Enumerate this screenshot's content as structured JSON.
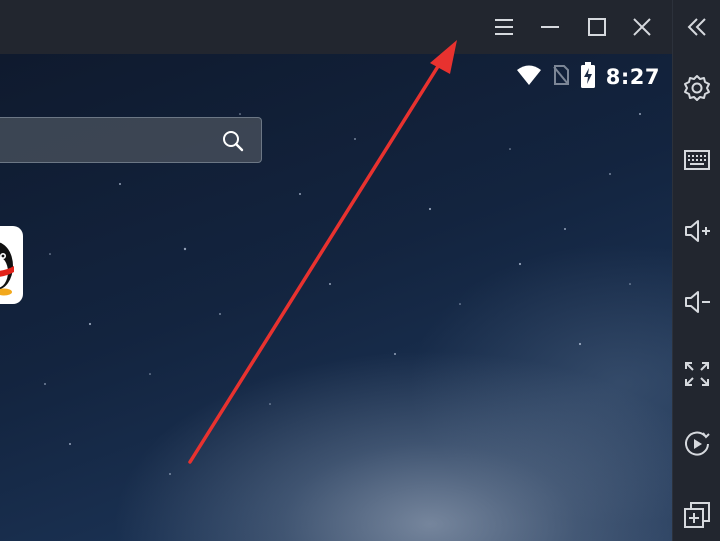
{
  "status_bar": {
    "time": "8:27"
  },
  "search": {
    "placeholder": ""
  },
  "title_bar": {
    "icons": [
      "menu-icon",
      "minimize-icon",
      "maximize-icon",
      "close-icon"
    ]
  },
  "sidebar": {
    "icons": [
      "collapse-icon",
      "settings-icon",
      "keyboard-icon",
      "volume-up-icon",
      "volume-down-icon",
      "fullscreen-icon",
      "record-icon",
      "multi-instance-icon"
    ]
  },
  "annotation": {
    "arrow_color": "#e8322f"
  },
  "colors": {
    "chrome": "#22262f",
    "icon": "#d6d9de"
  }
}
